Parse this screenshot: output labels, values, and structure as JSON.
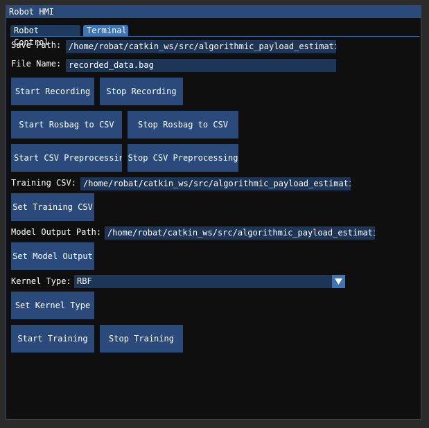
{
  "window": {
    "title": "Robot HMI"
  },
  "tabs": [
    {
      "label": "Robot Control"
    },
    {
      "label": "Terminal"
    }
  ],
  "save_path": {
    "label": "Save Path:",
    "value": "/home/robat/catkin_ws/src/algorithmic_payload_estimatio"
  },
  "file_name": {
    "label": "File Name:",
    "value": "recorded_data.bag"
  },
  "buttons": {
    "start_recording": "Start Recording",
    "stop_recording": "Stop Recording",
    "start_rosbag_csv": "Start Rosbag to CSV",
    "stop_rosbag_csv": "Stop Rosbag to CSV",
    "start_csv_preprocessing": "Start CSV Preprocessing",
    "stop_csv_preprocessing": "Stop CSV Preprocessing",
    "set_training_csv": "Set Training CSV",
    "set_model_output": "Set Model Output",
    "set_kernel_type": "Set Kernel Type",
    "start_training": "Start Training",
    "stop_training": "Stop Training"
  },
  "training_csv": {
    "label": "Training CSV:",
    "value": "/home/robat/catkin_ws/src/algorithmic_payload_estimatio"
  },
  "model_output": {
    "label": "Model Output Path:",
    "value": "/home/robat/catkin_ws/src/algorithmic_payload_estimatio"
  },
  "kernel_type": {
    "label": "Kernel Type:",
    "value": "RBF"
  },
  "icons": {
    "combo_arrow": "triangle-down-icon"
  }
}
